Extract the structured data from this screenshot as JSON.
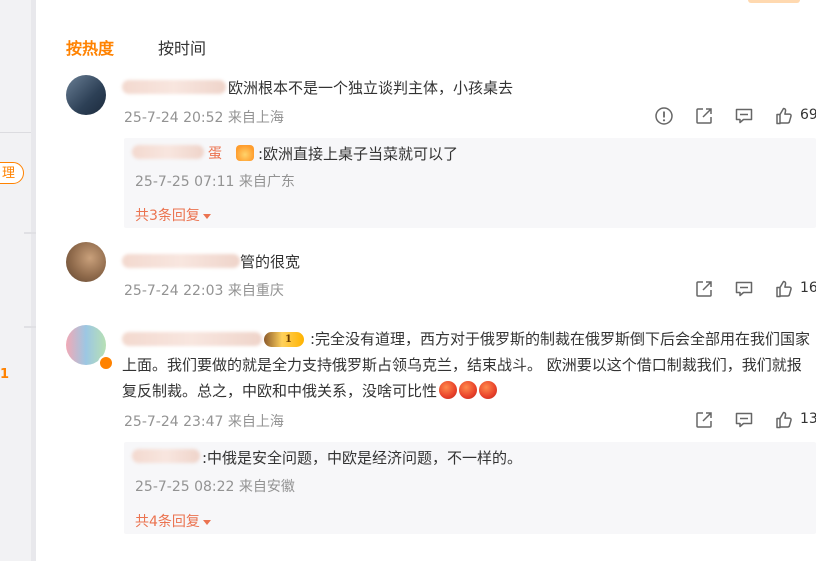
{
  "tabs": {
    "hot": "按热度",
    "time": "按时间"
  },
  "sidebar": {
    "pill_text": "理",
    "mark_text": "1"
  },
  "comments": [
    {
      "text": "欧洲根本不是一个独立谈判主体，小孩桌去",
      "time": "25-7-24 20:52",
      "location": "来自上海",
      "likes": "69",
      "reply": {
        "text": ":欧洲直接上桌子当菜就可以了",
        "name_tail": "蛋",
        "time": "25-7-25 07:11",
        "location": "来自广东"
      },
      "more_replies": "共3条回复"
    },
    {
      "text": "管的很宽",
      "time": "25-7-24 22:03",
      "location": "来自重庆",
      "likes": "16"
    },
    {
      "text": ":完全没有道理，西方对于俄罗斯的制裁在俄罗斯倒下后会全部用在我们国家上面。我们要做的就是全力支持俄罗斯占领乌克兰，结束战斗。 欧洲要以这个借口制裁我们，我们就报复反制裁。总之，中欧和中俄关系，没啥可比性",
      "vip_level": "1",
      "time": "25-7-24 23:47",
      "location": "来自上海",
      "likes": "13",
      "reply": {
        "text": ":中俄是安全问题，中欧是经济问题，不一样的。",
        "time": "25-7-25 08:22",
        "location": "来自安徽"
      },
      "more_replies": "共4条回复"
    }
  ],
  "icons": {
    "report": "report-icon",
    "share": "share-icon",
    "comment": "comment-icon",
    "like": "like-icon",
    "emoji": "angry-face-emoji-icon"
  },
  "colors": {
    "accent": "#ff8200",
    "reply_link": "#eb7350",
    "meta": "#939393"
  }
}
